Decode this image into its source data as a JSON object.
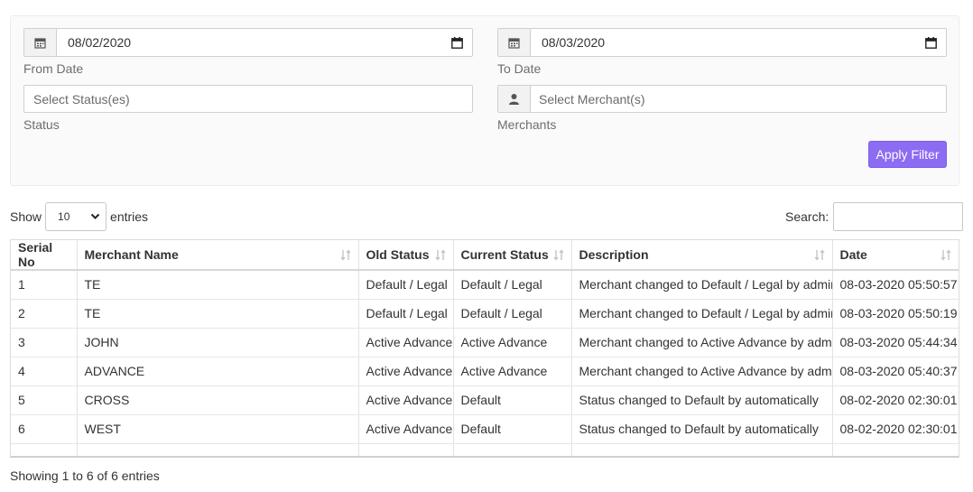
{
  "filters": {
    "from_date": {
      "value": "08/02/2020",
      "label": "From Date",
      "icon": "calendar-icon"
    },
    "to_date": {
      "value": "08/03/2020",
      "label": "To Date",
      "icon": "calendar-icon"
    },
    "status": {
      "placeholder": "Select Status(es)",
      "label": "Status"
    },
    "merchants": {
      "placeholder": "Select Merchant(s)",
      "label": "Merchants",
      "icon": "user-icon"
    },
    "apply_label": "Apply Filter",
    "accent_color": "#8c6cf2"
  },
  "table_controls": {
    "show_label": "Show",
    "entries_value": "10",
    "entries_label": "entries",
    "search_label": "Search:"
  },
  "table": {
    "columns": [
      "Serial No",
      "Merchant Name",
      "Old Status",
      "Current Status",
      "Description",
      "Date"
    ],
    "rows": [
      [
        "1",
        "TE",
        "Default / Legal",
        "Default / Legal",
        "Merchant changed to Default / Legal by admin",
        "08-03-2020 05:50:57"
      ],
      [
        "2",
        "TE",
        "Default / Legal",
        "Default / Legal",
        "Merchant changed to Default / Legal by admin",
        "08-03-2020 05:50:19"
      ],
      [
        "3",
        "JOHN",
        "Active Advance",
        "Active Advance",
        "Merchant changed to Active Advance by admin",
        "08-03-2020 05:44:34"
      ],
      [
        "4",
        "ADVANCE",
        "Active Advance",
        "Active Advance",
        "Merchant changed to Active Advance by admin",
        "08-03-2020 05:40:37"
      ],
      [
        "5",
        "CROSS",
        "Active Advance",
        "Default",
        "Status changed to Default by automatically",
        "08-02-2020 02:30:01"
      ],
      [
        "6",
        "WEST",
        "Active Advance",
        "Default",
        "Status changed to Default by automatically",
        "08-02-2020 02:30:01"
      ]
    ]
  },
  "footer": {
    "info": "Showing 1 to 6 of 6 entries"
  }
}
